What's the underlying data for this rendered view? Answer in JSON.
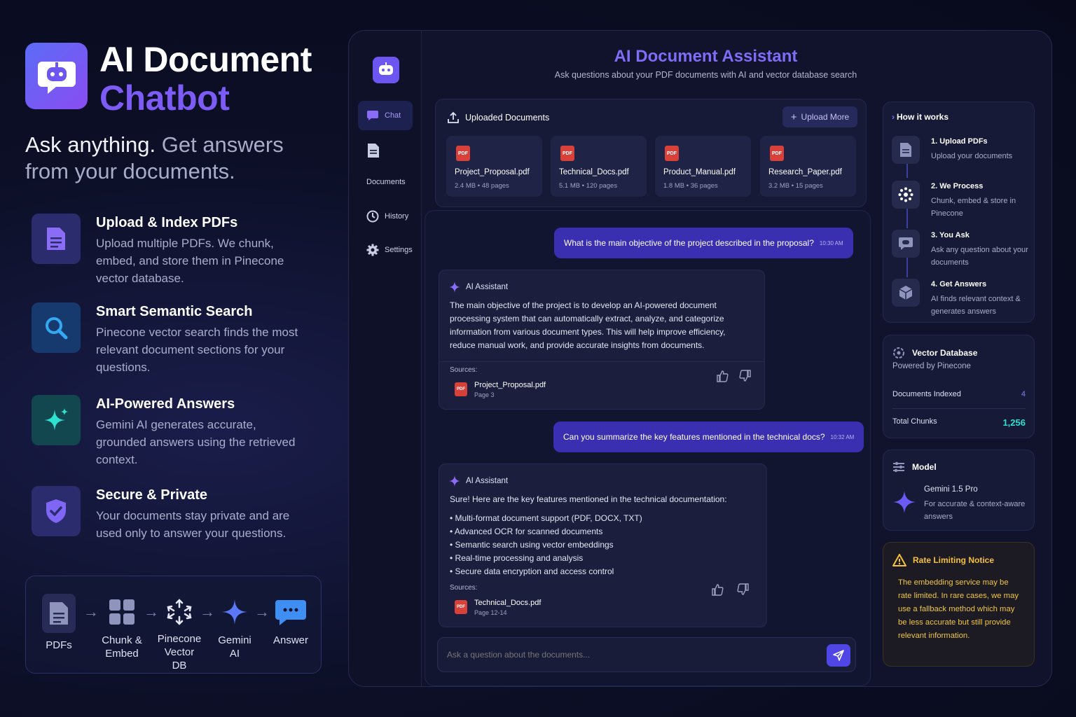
{
  "hero": {
    "title_line1": "AI Document",
    "title_line2": "Chatbot",
    "tagline_a": "Ask anything.",
    "tagline_b": "Get answers from your documents."
  },
  "features": [
    {
      "title": "Upload & Index PDFs",
      "desc": "Upload multiple PDFs. We chunk, embed, and store them in Pinecone vector database.",
      "icon": "document-icon",
      "color": "#6b5bf5"
    },
    {
      "title": "Smart Semantic Search",
      "desc": "Pinecone vector search finds the most relevant document sections for your questions.",
      "icon": "search-icon",
      "color": "#2fa4f0"
    },
    {
      "title": "AI-Powered Answers",
      "desc": "Gemini AI generates accurate, grounded answers using the retrieved context.",
      "icon": "sparkle-icon",
      "color": "#22d1c4"
    },
    {
      "title": "Secure & Private",
      "desc": "Your documents stay private and are used only to answer your questions.",
      "icon": "shield-icon",
      "color": "#6b5bf5"
    }
  ],
  "pipeline": [
    {
      "label": "PDFs",
      "icon": "document-icon"
    },
    {
      "label": "Chunk & Embed",
      "icon": "grid-icon"
    },
    {
      "label": "Pinecone Vector DB",
      "icon": "pinecone-icon"
    },
    {
      "label": "Gemini AI",
      "icon": "sparkle-icon"
    },
    {
      "label": "Answer",
      "icon": "chat-bubble-icon"
    }
  ],
  "app": {
    "title": "AI Document Assistant",
    "subtitle": "Ask questions about your PDF documents with AI and vector database search"
  },
  "nav": [
    {
      "label": "Chat",
      "icon": "chat-icon",
      "active": true
    },
    {
      "label": "Documents",
      "icon": "document-icon",
      "active": false
    },
    {
      "label": "History",
      "icon": "clock-icon",
      "active": false
    },
    {
      "label": "Settings",
      "icon": "gear-icon",
      "active": false
    }
  ],
  "uploaded": {
    "header": "Uploaded Documents",
    "upload_more": "Upload More",
    "pdf_badge": "PDF",
    "docs": [
      {
        "name": "Project_Proposal.pdf",
        "meta": "2.4 MB • 48 pages"
      },
      {
        "name": "Technical_Docs.pdf",
        "meta": "5.1 MB • 120 pages"
      },
      {
        "name": "Product_Manual.pdf",
        "meta": "1.8 MB • 36 pages"
      },
      {
        "name": "Research_Paper.pdf",
        "meta": "3.2 MB • 15 pages"
      }
    ]
  },
  "chat": {
    "assistant_label": "AI Assistant",
    "sources_label": "Sources:",
    "messages": [
      {
        "user": "What is the main objective of the project described in the proposal?",
        "time": "10:30 AM"
      },
      {
        "answer": "The main objective of the project is to develop an AI-powered document processing system that can automatically extract, analyze, and categorize information from various document types. This will help improve efficiency, reduce manual work, and provide accurate insights from documents.",
        "source_name": "Project_Proposal.pdf",
        "source_page": "Page 3"
      },
      {
        "user": "Can you summarize the key features mentioned in the technical docs?",
        "time": "10:32 AM"
      },
      {
        "answer_intro": "Sure! Here are the key features mentioned in the technical documentation:",
        "bullets": [
          "Multi-format document support (PDF, DOCX, TXT)",
          "Advanced OCR for scanned documents",
          "Semantic search using vector embeddings",
          "Real-time processing and analysis",
          "Secure data encryption and access control"
        ],
        "source_name": "Technical_Docs.pdf",
        "source_page": "Page 12-14"
      }
    ],
    "input_placeholder": "Ask a question about the documents..."
  },
  "how": {
    "header": "How it works",
    "steps": [
      {
        "title": "1. Upload PDFs",
        "desc": "Upload your documents"
      },
      {
        "title": "2. We Process",
        "desc": "Chunk, embed & store in Pinecone"
      },
      {
        "title": "3. You Ask",
        "desc": "Ask any question about your documents"
      },
      {
        "title": "4. Get Answers",
        "desc": "AI finds relevant context & generates answers"
      }
    ]
  },
  "vector_db": {
    "title": "Vector Database",
    "subtitle": "Powered by Pinecone",
    "indexed_label": "Documents Indexed",
    "indexed_value": "4",
    "chunks_label": "Total Chunks",
    "chunks_value": "1,256"
  },
  "model": {
    "header": "Model",
    "name": "Gemini 1.5 Pro",
    "desc": "For accurate & context-aware answers"
  },
  "notice": {
    "title": "Rate Limiting Notice",
    "text": "The embedding service may be rate limited. In rare cases, we may use a fallback method which may be less accurate but still provide relevant information."
  }
}
